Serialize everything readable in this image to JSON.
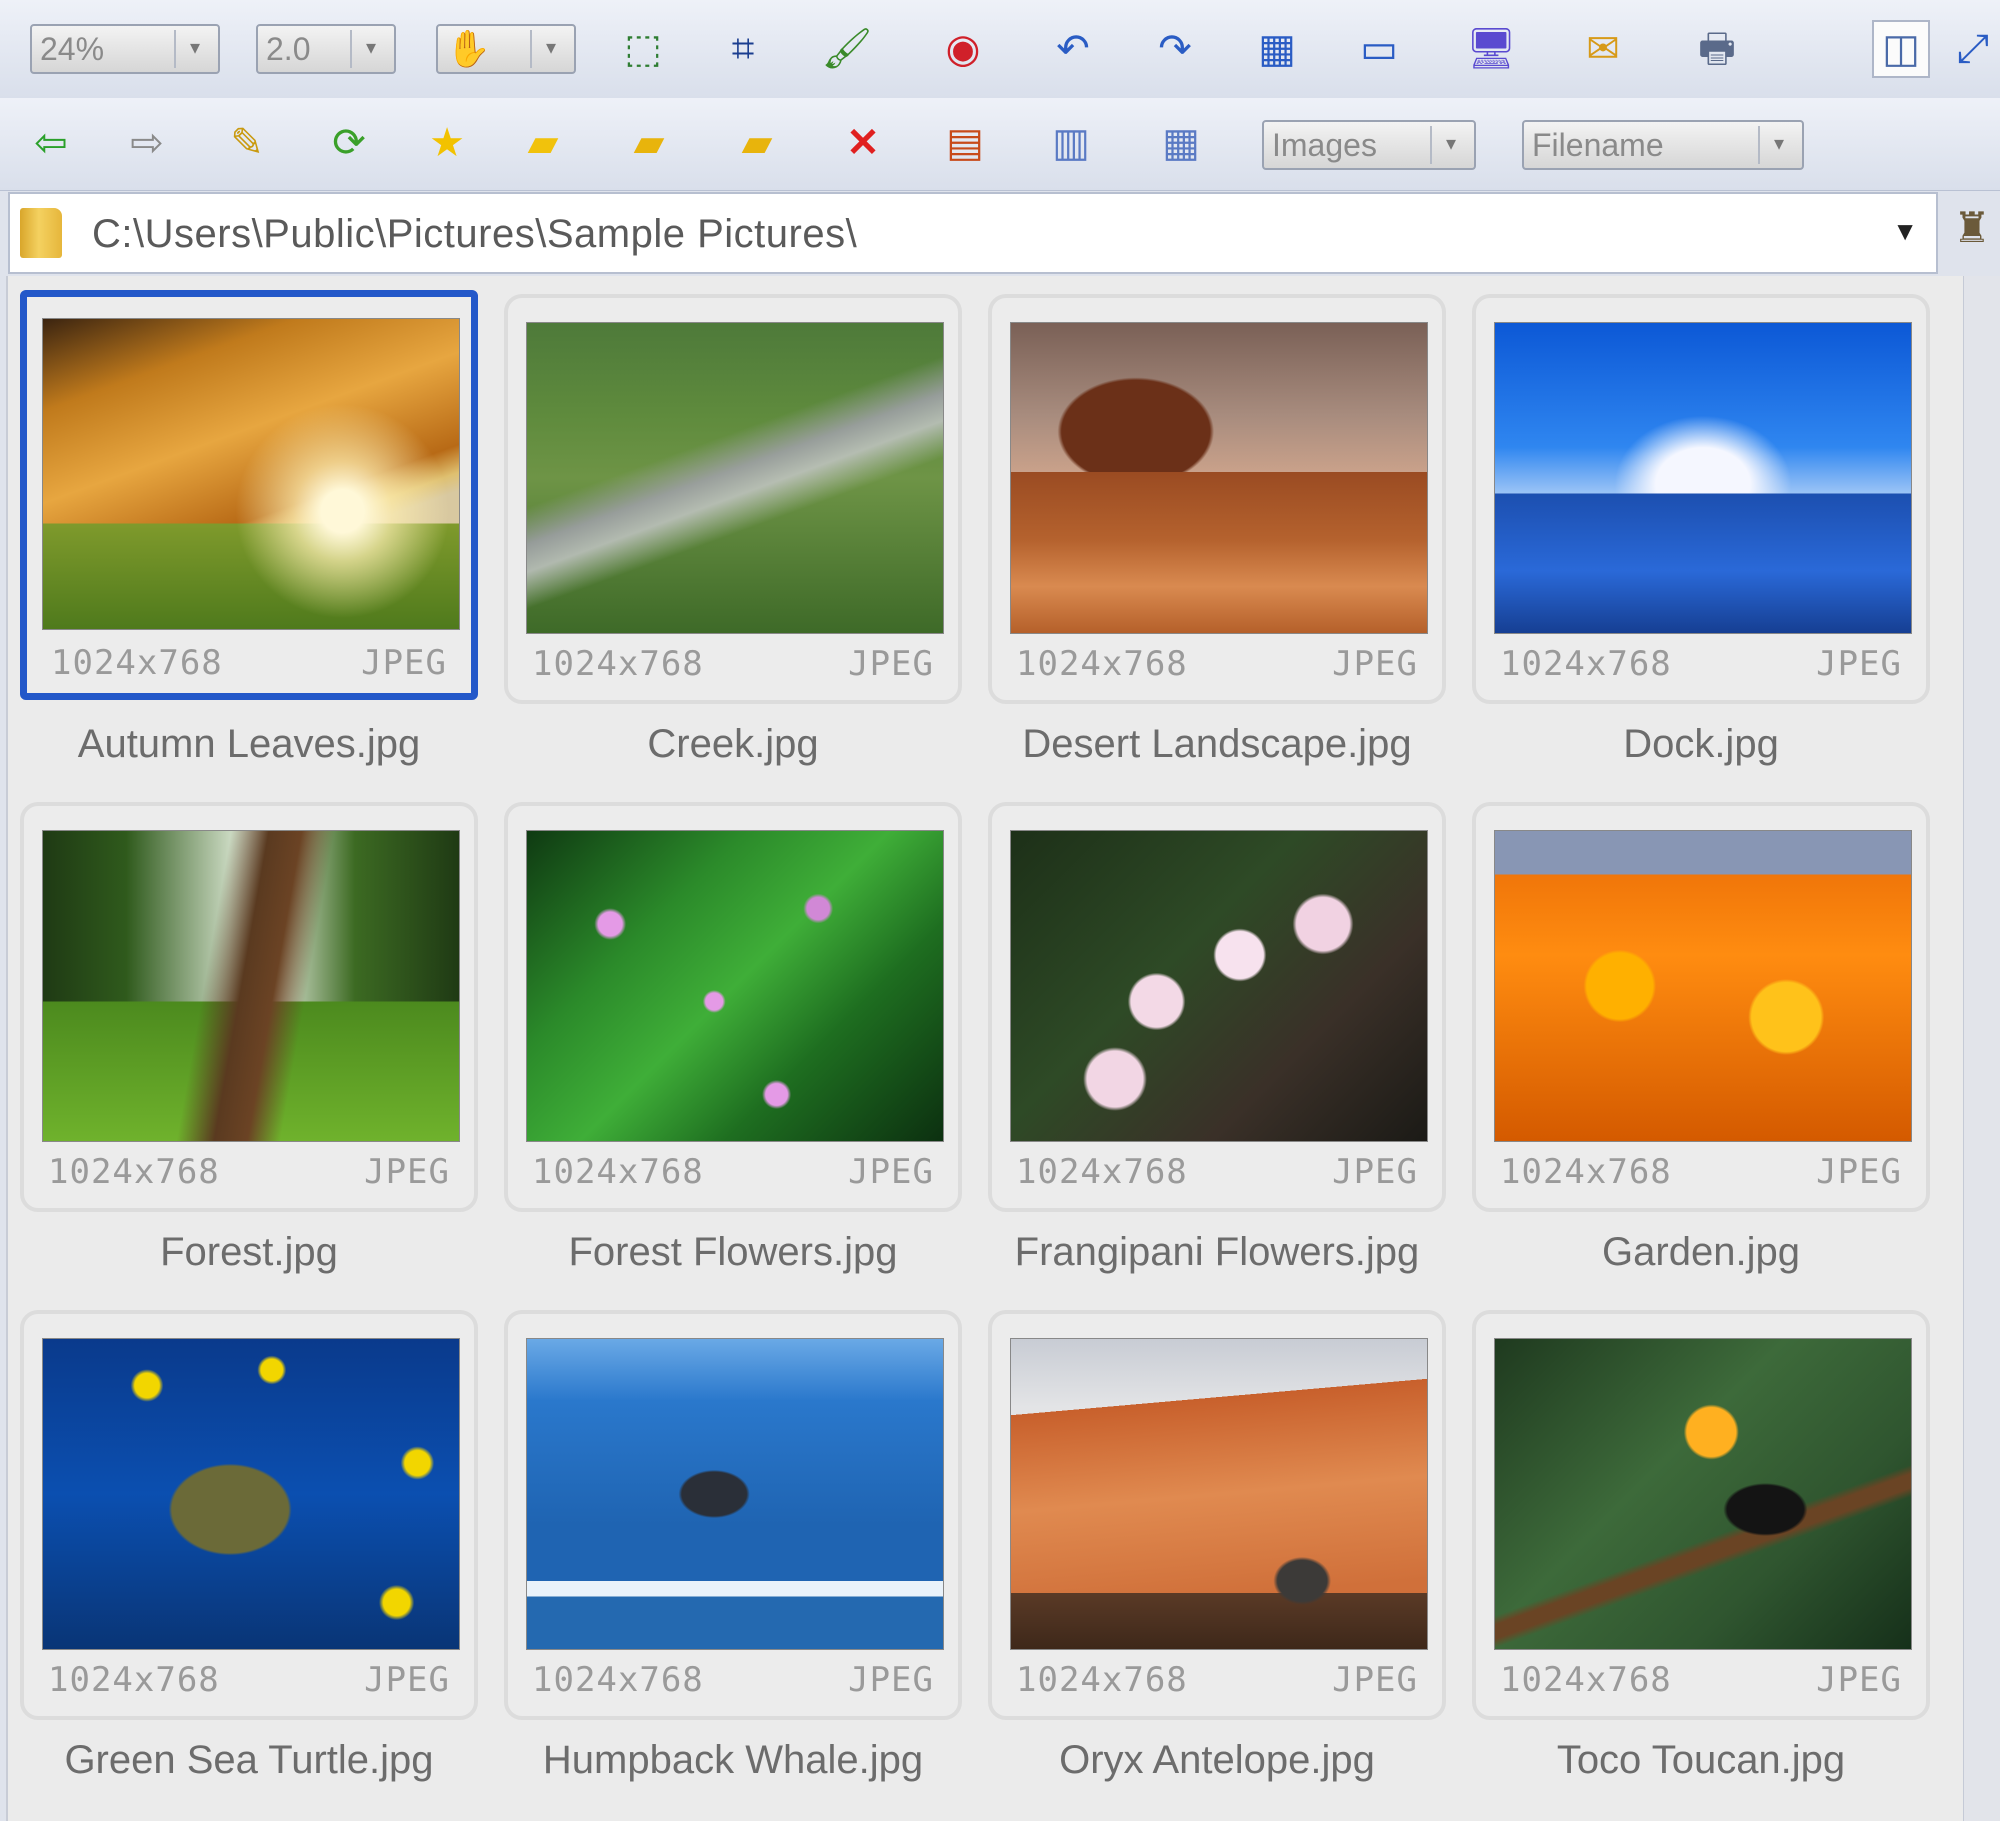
{
  "toolbar1": {
    "zoom": "24%",
    "gamma": "2.0",
    "hand_label": "",
    "buttons": [
      {
        "name": "select-icon",
        "glyph": "⬚"
      },
      {
        "name": "crop-icon",
        "glyph": "⌗"
      },
      {
        "name": "paint-icon",
        "glyph": "🖌"
      },
      {
        "name": "red-eye-icon",
        "glyph": "◉"
      },
      {
        "name": "rotate-left-icon",
        "glyph": "↶"
      },
      {
        "name": "rotate-right-icon",
        "glyph": "↷"
      },
      {
        "name": "fit-window-icon",
        "glyph": "▦"
      },
      {
        "name": "fullscreen-icon",
        "glyph": "▭"
      },
      {
        "name": "wallpaper-icon",
        "glyph": "🖥"
      },
      {
        "name": "email-icon",
        "glyph": "✉"
      },
      {
        "name": "print-icon",
        "glyph": "🖶"
      },
      {
        "name": "layout-icon",
        "glyph": "◫"
      },
      {
        "name": "expand-icon",
        "glyph": "⤢"
      }
    ]
  },
  "toolbar2": {
    "filter_value": "Images",
    "sort_value": "Filename",
    "buttons": [
      {
        "name": "back-icon",
        "glyph": "⇦"
      },
      {
        "name": "forward-icon",
        "glyph": "⇨"
      },
      {
        "name": "edit-icon",
        "glyph": "✎"
      },
      {
        "name": "refresh-icon",
        "glyph": "⟳"
      },
      {
        "name": "favorite-star-icon",
        "glyph": "★"
      },
      {
        "name": "new-folder-icon",
        "glyph": "▰"
      },
      {
        "name": "move-folder-icon",
        "glyph": "▰"
      },
      {
        "name": "copy-folder-icon",
        "glyph": "▰"
      },
      {
        "name": "delete-icon",
        "glyph": "✕"
      },
      {
        "name": "thumbnails-view-icon",
        "glyph": "▤"
      },
      {
        "name": "columns-view-icon",
        "glyph": "▥"
      },
      {
        "name": "details-view-icon",
        "glyph": "▦"
      }
    ]
  },
  "address": {
    "path": "C:\\Users\\Public\\Pictures\\Sample Pictures\\"
  },
  "colors": {
    "selection": "#2358c9",
    "toolbar_bg": "#e3e7f0"
  },
  "thumbnails": [
    {
      "filename": "Autumn Leaves.jpg",
      "dims": "1024x768",
      "format": "JPEG",
      "selected": true
    },
    {
      "filename": "Creek.jpg",
      "dims": "1024x768",
      "format": "JPEG"
    },
    {
      "filename": "Desert Landscape.jpg",
      "dims": "1024x768",
      "format": "JPEG"
    },
    {
      "filename": "Dock.jpg",
      "dims": "1024x768",
      "format": "JPEG"
    },
    {
      "filename": "Forest.jpg",
      "dims": "1024x768",
      "format": "JPEG"
    },
    {
      "filename": "Forest Flowers.jpg",
      "dims": "1024x768",
      "format": "JPEG"
    },
    {
      "filename": "Frangipani Flowers.jpg",
      "dims": "1024x768",
      "format": "JPEG"
    },
    {
      "filename": "Garden.jpg",
      "dims": "1024x768",
      "format": "JPEG"
    },
    {
      "filename": "Green Sea Turtle.jpg",
      "dims": "1024x768",
      "format": "JPEG"
    },
    {
      "filename": "Humpback Whale.jpg",
      "dims": "1024x768",
      "format": "JPEG"
    },
    {
      "filename": "Oryx Antelope.jpg",
      "dims": "1024x768",
      "format": "JPEG"
    },
    {
      "filename": "Toco Toucan.jpg",
      "dims": "1024x768",
      "format": "JPEG"
    }
  ]
}
